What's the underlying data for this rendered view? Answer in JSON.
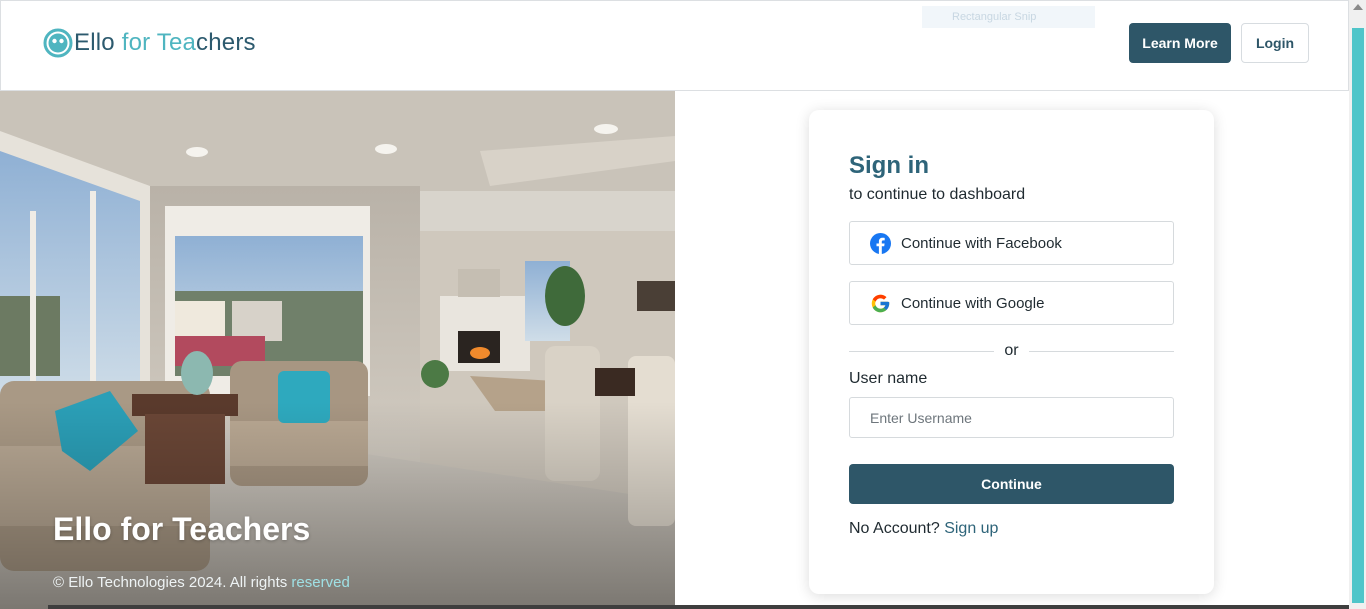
{
  "header": {
    "logo": {
      "part1": "Ello",
      "part2": " for Tea",
      "part3": "chers"
    },
    "ghost_label": "Rectangular Snip",
    "learn_more_label": "Learn More",
    "login_label": "Login"
  },
  "hero": {
    "title": "Ello for Teachers",
    "copyright_prefix": "© Ello Technologies 2024. All rights ",
    "copyright_highlight": "reserved"
  },
  "signin": {
    "title": "Sign in",
    "subtitle": "to continue to dashboard",
    "facebook_label": "Continue with Facebook",
    "google_label": "Continue with Google",
    "or_label": "or",
    "username_label": "User name",
    "username_placeholder": "Enter Username",
    "username_value": "",
    "continue_label": "Continue",
    "no_account_label": "No Account?",
    "signup_label": "Sign up"
  },
  "icons": {
    "logo": "ello-smiley-icon",
    "facebook": "facebook-icon",
    "google": "google-icon"
  },
  "colors": {
    "primary": "#2e5668",
    "accent": "#4fb5c0",
    "title": "#2e6479",
    "scrollbar": "#4fc5c9"
  }
}
